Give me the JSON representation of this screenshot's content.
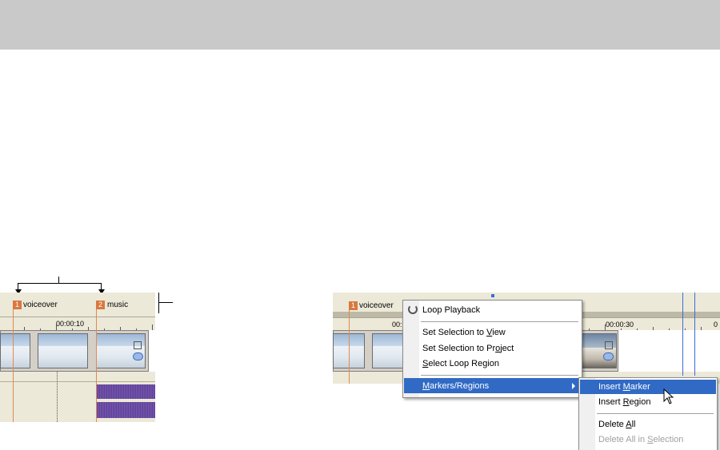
{
  "left_timeline": {
    "markers": [
      {
        "number": "1",
        "label": "voiceover"
      },
      {
        "number": "2",
        "label": "music"
      }
    ],
    "timecode": "00:00:10"
  },
  "right_timeline": {
    "markers": [
      {
        "number": "1",
        "label": "voiceover"
      }
    ],
    "timecode_partial": "00:",
    "timecode": "00:00:30",
    "timecode_edge": "0"
  },
  "context_menu": {
    "items": [
      {
        "pre": "Loop Playback",
        "key": "",
        "post": ""
      },
      {
        "pre": "Set Selection to ",
        "key": "V",
        "post": "iew"
      },
      {
        "pre": "Set Selection to Pr",
        "key": "o",
        "post": "ject"
      },
      {
        "pre": "",
        "key": "S",
        "post": "elect Loop Region"
      },
      {
        "pre": "",
        "key": "M",
        "post": "arkers/Regions"
      }
    ]
  },
  "submenu": {
    "items": [
      {
        "pre": "Insert ",
        "key": "M",
        "post": "arker"
      },
      {
        "pre": "Insert ",
        "key": "R",
        "post": "egion"
      },
      {
        "pre": "Delete ",
        "key": "A",
        "post": "ll"
      },
      {
        "pre": "Delete All in ",
        "key": "S",
        "post": "election"
      }
    ]
  },
  "colors": {
    "marker": "#d9783f",
    "highlight": "#316ac5",
    "panel": "#ece9d8"
  }
}
